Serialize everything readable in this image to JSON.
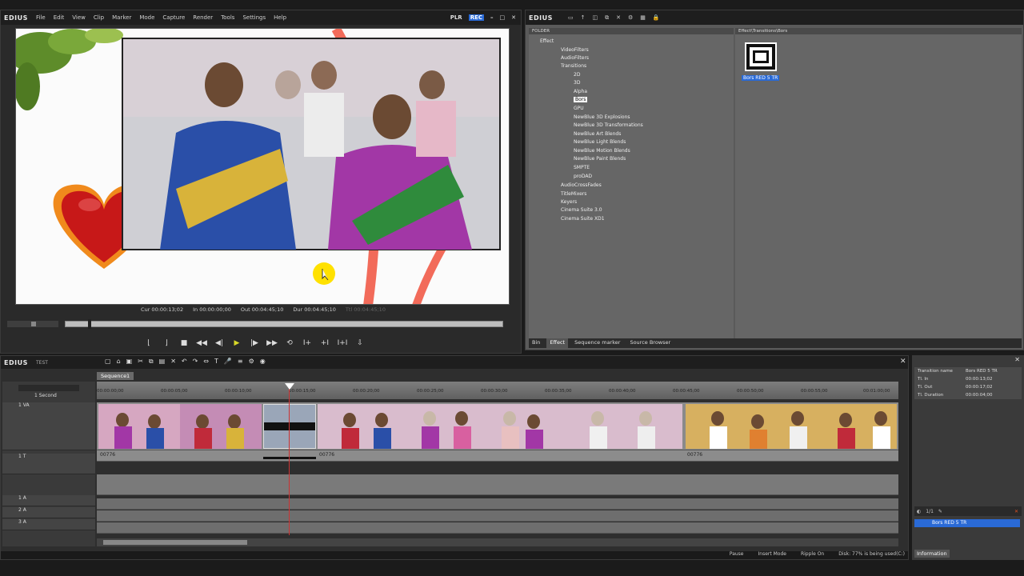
{
  "player": {
    "brand": "EDIUS",
    "menu": [
      "File",
      "Edit",
      "View",
      "Clip",
      "Marker",
      "Mode",
      "Capture",
      "Render",
      "Tools",
      "Settings",
      "Help"
    ],
    "plr_label": "PLR",
    "rec_label": "REC",
    "timecodes": {
      "cur": "Cur 00:00:13;02",
      "in": "In 00:00:00;00",
      "out": "Out 00:04:45;10",
      "dur": "Dur 00:04:45;10",
      "ttl": "Ttl 00:04:45;10"
    }
  },
  "effects": {
    "brand": "EDIUS",
    "folder_header": "FOLDER",
    "fx_header": "Effect\\Transitions\\Bors",
    "tree": [
      "Effect",
      "VideoFilters",
      "AudioFilters",
      "Transitions",
      "2D",
      "3D",
      "Alpha",
      "Bors",
      "GPU",
      "NewBlue 3D Explosions",
      "NewBlue 3D Transformations",
      "NewBlue Art Blends",
      "NewBlue Light Blends",
      "NewBlue Motion Blends",
      "NewBlue Paint Blends",
      "SMPTE",
      "proDAD",
      "AudioCrossFades",
      "TitleMixers",
      "Keyers",
      "Cinema Suite 3.0",
      "Cinema Suite XD1"
    ],
    "fx_item_label": "Bors RED 5 TR",
    "tabs": [
      "Bin",
      "Effect",
      "Sequence marker",
      "Source Browser"
    ]
  },
  "timeline": {
    "brand": "EDIUS",
    "project": "TEST",
    "sequence_tab": "Sequence1",
    "zoom": "1 Second",
    "ruler_ticks": [
      "00:00:00;00",
      "00:00:05;00",
      "00:00:10;00",
      "00:00:15;00",
      "00:00:20;00",
      "00:00:25;00",
      "00:00:30;00",
      "00:00:35;00",
      "00:00:40;00",
      "00:00:45;00",
      "00:00:50;00",
      "00:00:55;00",
      "00:01:00;00"
    ],
    "tracks": [
      "1 VA",
      "1 T",
      "1 A",
      "2 A",
      "3 A"
    ],
    "clip_label": "00776",
    "status": [
      "Pause",
      "Insert Mode",
      "Ripple On",
      "Disk: 77% is being used(C:)"
    ]
  },
  "info": {
    "rows": [
      {
        "k": "Transition name",
        "v": "Bors RED 5 TR"
      },
      {
        "k": "Tl. In",
        "v": "00:00:13;02"
      },
      {
        "k": "Tl. Out",
        "v": "00:00:17;02"
      },
      {
        "k": "Tl. Duration",
        "v": "00:00:04;00"
      }
    ],
    "counter": "1/1",
    "selected": "Bors RED 5 TR",
    "tab": "Information"
  }
}
